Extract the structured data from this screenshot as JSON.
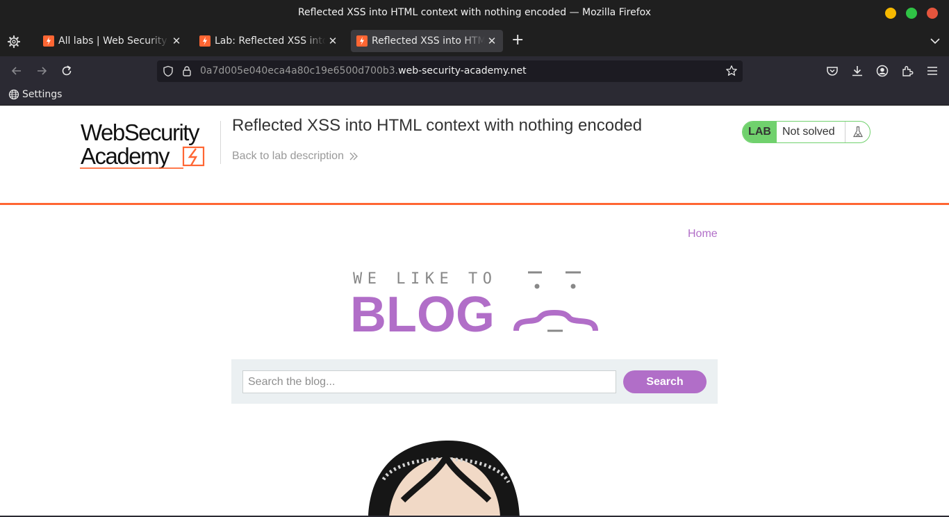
{
  "window": {
    "title": "Reflected XSS into HTML context with nothing encoded — Mozilla Firefox",
    "buttons": {
      "minimize_color": "#f5b800",
      "maximize_color": "#2fc345",
      "close_color": "#e5553d"
    }
  },
  "tabs": [
    {
      "label": "All labs | Web Security Academy",
      "active": false
    },
    {
      "label": "Lab: Reflected XSS into HTML context with nothing encoded",
      "active": false
    },
    {
      "label": "Reflected XSS into HTML context with nothing encoded",
      "active": true
    }
  ],
  "toolbar": {
    "url_prefix": "0a7d005e040eca4a80c19e6500d700b3.",
    "url_host": "web-security-academy.net"
  },
  "bookmarks": [
    {
      "label": "Settings",
      "icon": "globe-icon"
    }
  ],
  "academy": {
    "logo_text_line1": "WebSecurity",
    "logo_text_line2": "Academy",
    "lab_title": "Reflected XSS into HTML context with nothing encoded",
    "back_link": "Back to lab description",
    "lab_badge": "LAB",
    "lab_status": "Not solved",
    "accent_color": "#ff6633",
    "status_color": "#70d16d"
  },
  "blog": {
    "nav": [
      "Home"
    ],
    "banner_line1": "WE LIKE TO",
    "banner_line2": "BLOG",
    "search_placeholder": "Search the blog...",
    "search_value": "",
    "search_button": "Search",
    "brand_color": "#b16ec8"
  }
}
